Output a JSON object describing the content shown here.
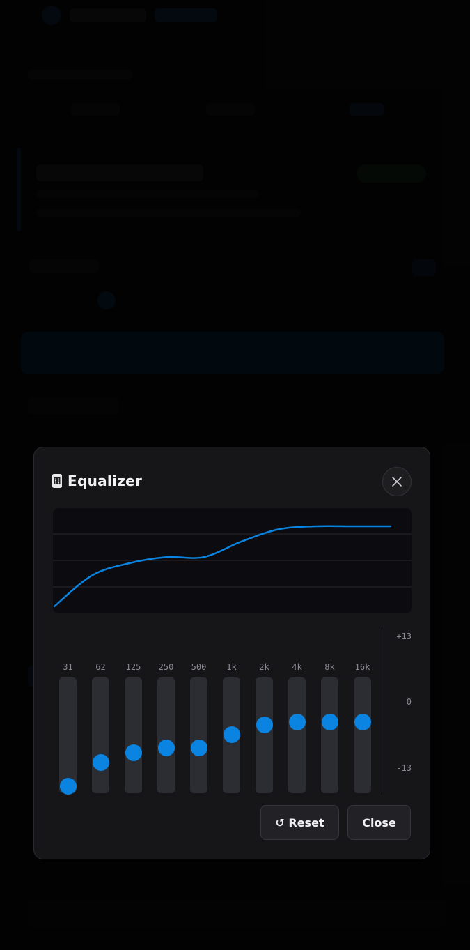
{
  "modal": {
    "title": "Equalizer",
    "reset_label": "↺ Reset",
    "close_label": "Close"
  },
  "scale": {
    "max": "+13",
    "zero": "0",
    "min": "-13"
  },
  "bands": [
    {
      "label": "31",
      "gain": -13
    },
    {
      "label": "62",
      "gain": -8
    },
    {
      "label": "125",
      "gain": -6
    },
    {
      "label": "250",
      "gain": -5
    },
    {
      "label": "500",
      "gain": -5
    },
    {
      "label": "1k",
      "gain": -2.5
    },
    {
      "label": "2k",
      "gain": -0.5
    },
    {
      "label": "4k",
      "gain": 0
    },
    {
      "label": "8k",
      "gain": 0
    },
    {
      "label": "16k",
      "gain": 0
    }
  ],
  "colors": {
    "accent": "#0a84e0",
    "track": "#2c2c33",
    "panel": "#161618"
  }
}
